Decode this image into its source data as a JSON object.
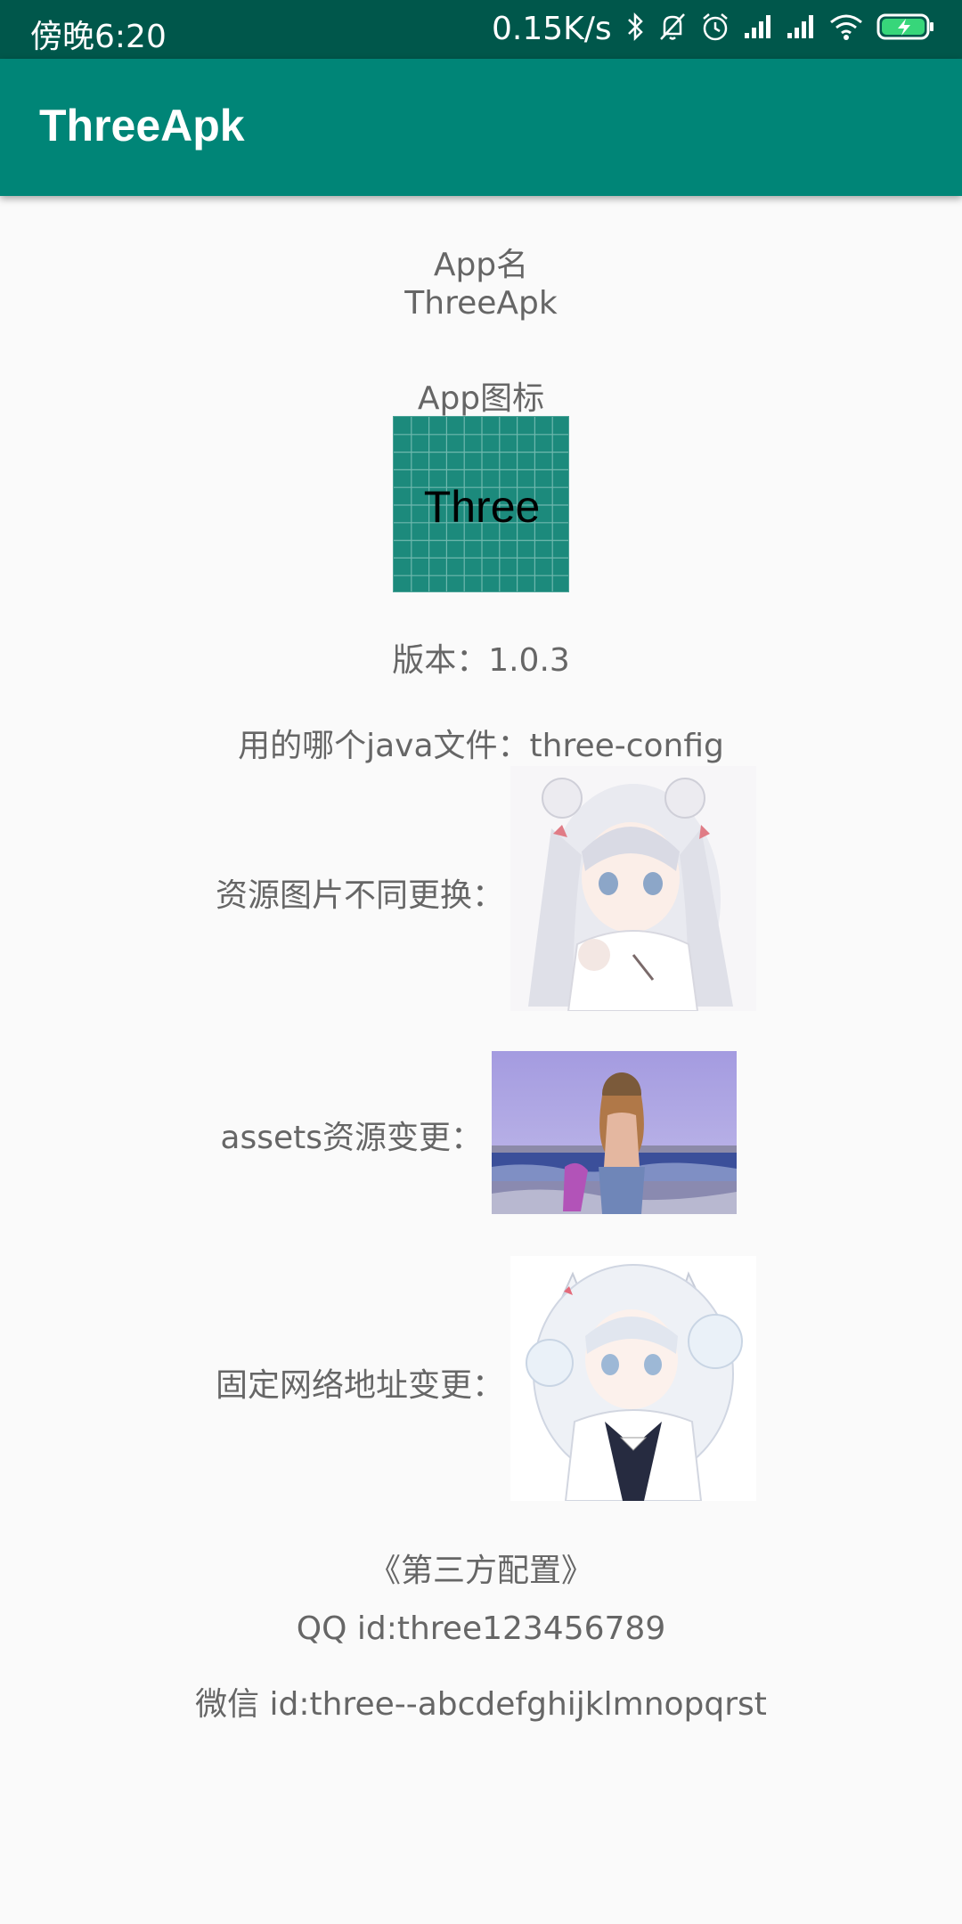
{
  "status_bar": {
    "time": "傍晚6:20",
    "speed": "0.15K/s",
    "icons": [
      "bluetooth-icon",
      "mute-icon",
      "alarm-icon",
      "signal-icon",
      "signal-icon",
      "wifi-icon",
      "battery-charging-icon"
    ]
  },
  "app_bar": {
    "title": "ThreeApk",
    "color": "#008577"
  },
  "info": {
    "app_name_label": "App名",
    "app_name_value": "ThreeApk",
    "app_icon_label": "App图标",
    "app_icon_text": "Three",
    "version": "版本：1.0.3",
    "java_file": "用的哪个java文件：three-config",
    "res_image_label": "资源图片不同更换：",
    "assets_label": "assets资源变更：",
    "network_label": "固定网络地址变更：",
    "third_party": "《第三方配置》",
    "qq_id": "QQ id:three123456789",
    "wechat_id": "微信 id:three--abcdefghijklmnopqrst"
  },
  "colors": {
    "status_bar": "#00574b",
    "accent": "#008577",
    "text": "#666666",
    "background": "#fafafa"
  }
}
